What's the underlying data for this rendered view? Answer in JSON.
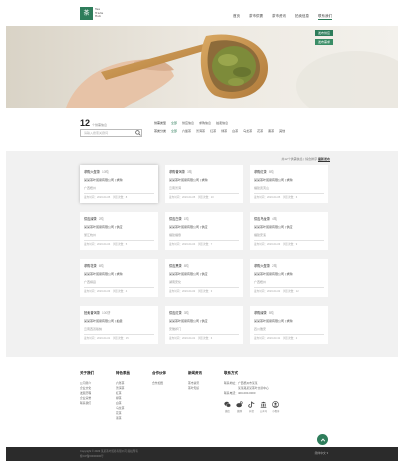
{
  "header": {
    "logo_mark": "茶",
    "logo_lines": [
      "Tea",
      "Trade",
      "Hub"
    ],
    "nav": [
      "首页",
      "茶市供需",
      "茶市资讯",
      "拍卖信息",
      "联系我们"
    ],
    "active_nav": 4
  },
  "hero": {
    "buttons": [
      "发布供应",
      "发布需求"
    ]
  },
  "filter": {
    "count": "12",
    "count_unit": "个供需信息",
    "search_placeholder": "请输入搜索关键词",
    "row1": {
      "label": "供需类型",
      "options": [
        "全部",
        "供应信息",
        "求购信息",
        "拍卖信息"
      ],
      "selected": 0
    },
    "row2": {
      "label": "茶类分类",
      "options": [
        "全部",
        "六堡茶",
        "普洱茶",
        "红茶",
        "绿茶",
        "白茶",
        "乌龙茶",
        "花茶",
        "黑茶",
        "其他"
      ],
      "selected": 0
    }
  },
  "listing": {
    "sort_text": "共12个供需信息 | 综合排序",
    "sort_bold": "最新发布",
    "cards": [
      {
        "title": "求购六堡茶",
        "tag": "10吨",
        "company": "某某茶叶贸易有限公司 | 求购",
        "region": "广西梧州",
        "meta": "发布时间：2023-04-05　浏览次数：8"
      },
      {
        "title": "求购普洱茶",
        "tag": "3吨",
        "company": "某某茶叶贸易有限公司 | 求购",
        "region": "云南普洱",
        "meta": "发布时间：2023-04-05　浏览次数：10"
      },
      {
        "title": "求购红茶",
        "tag": "5吨",
        "company": "某某茶叶贸易有限公司 | 求购",
        "region": "福建武夷山",
        "meta": "发布时间：2023-04-05　浏览次数：6"
      },
      {
        "title": "供应绿茶",
        "tag": "2吨",
        "company": "某某茶叶贸易有限公司 | 供应",
        "region": "浙江杭州",
        "meta": "发布时间：2023-04-04　浏览次数：5"
      },
      {
        "title": "供应白茶",
        "tag": "1吨",
        "company": "某某茶叶贸易有限公司 | 供应",
        "region": "福建福鼎",
        "meta": "发布时间：2023-04-04　浏览次数：7"
      },
      {
        "title": "供应乌龙茶",
        "tag": "4吨",
        "company": "某某茶叶贸易有限公司 | 供应",
        "region": "福建安溪",
        "meta": "发布时间：2023-04-03　浏览次数：9"
      },
      {
        "title": "求购花茶",
        "tag": "6吨",
        "company": "某某茶叶贸易有限公司 | 求购",
        "region": "广西横县",
        "meta": "发布时间：2023-04-03　浏览次数：4"
      },
      {
        "title": "供应黑茶",
        "tag": "8吨",
        "company": "某某茶叶贸易有限公司 | 供应",
        "region": "湖南安化",
        "meta": "发布时间：2023-04-02　浏览次数：3"
      },
      {
        "title": "求购六堡茶",
        "tag": "2吨",
        "company": "某某茶叶贸易有限公司 | 求购",
        "region": "广西梧州",
        "meta": "发布时间：2023-04-02　浏览次数：12"
      },
      {
        "title": "拍卖普洱茶",
        "tag": "100饼",
        "company": "某某茶叶贸易有限公司 | 拍卖",
        "region": "云南西双版纳",
        "meta": "发布时间：2023-04-01　浏览次数：15"
      },
      {
        "title": "供应红茶",
        "tag": "3吨",
        "company": "某某茶叶贸易有限公司 | 供应",
        "region": "安徽祁门",
        "meta": "发布时间：2023-04-01　浏览次数：6"
      },
      {
        "title": "求购绿茶",
        "tag": "5吨",
        "company": "某某茶叶贸易有限公司 | 求购",
        "region": "四川雅安",
        "meta": "发布时间：2023-03-31　浏览次数：2"
      }
    ]
  },
  "footer": {
    "columns": [
      {
        "title": "关于我们",
        "items": [
          "公司简介",
          "企业文化",
          "发展历程",
          "企业荣誉",
          "联系我们"
        ]
      },
      {
        "title": "特色茶品",
        "items": [
          "六堡茶",
          "普洱茶",
          "红茶",
          "绿茶",
          "白茶",
          "乌龙茶",
          "花茶",
          "黑茶"
        ]
      },
      {
        "title": "合作伙伴",
        "items": [
          "合作加盟"
        ]
      },
      {
        "title": "新闻资讯",
        "items": [
          "茶市资讯",
          "茶叶知识"
        ]
      }
    ],
    "contact": {
      "title": "联系方式",
      "rows": [
        "联系地址：广西梧州市某某",
        "　　　　　某某路某某茶叶交易中心",
        "联系电话：400-000-0000"
      ]
    },
    "social": [
      {
        "icon": "wechat-icon",
        "label": "微信"
      },
      {
        "icon": "weibo-icon",
        "label": "微博"
      },
      {
        "icon": "douyin-icon",
        "label": "抖音"
      },
      {
        "icon": "building-icon",
        "label": "公众号"
      },
      {
        "icon": "user-icon",
        "label": "小程序"
      }
    ],
    "bottom_line1": "Copyright © 2023 某某茶叶贸易有限公司 版权所有",
    "bottom_line2": "桂ICP备00000000号",
    "lang": "简体中文 ▾"
  },
  "colors": {
    "brand": "#2e7d5b",
    "bg_grey": "#f1f1f1",
    "footer_dark": "#2b2b2b"
  }
}
